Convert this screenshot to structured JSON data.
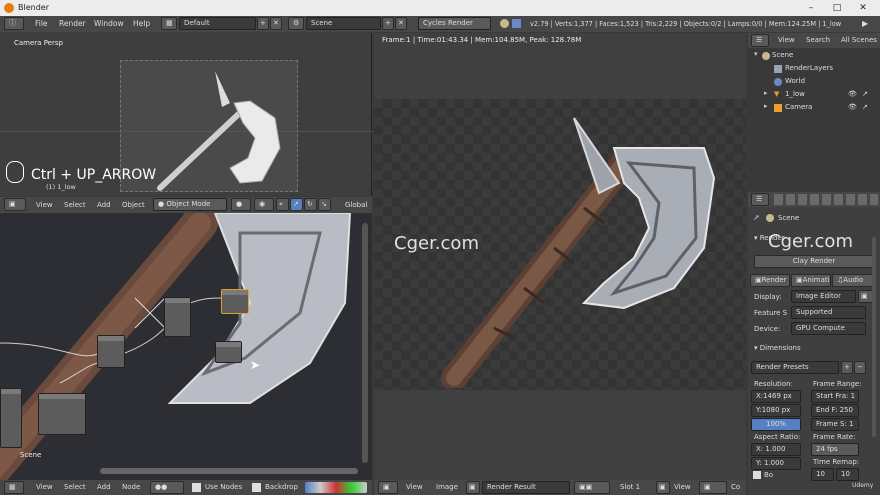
{
  "window": {
    "title": "Blender",
    "controls": [
      "–",
      "□",
      "✕"
    ]
  },
  "menubar": {
    "menus": [
      "File",
      "Render",
      "Window",
      "Help"
    ],
    "layout": "Default",
    "scene": "Scene",
    "engine": "Cycles Render",
    "stats": "v2.79 | Verts:1,377 | Faces:1,523 | Tris:2,229 | Objects:0/2 | Lamps:0/0 | Mem:124.25M | 1_low"
  },
  "viewport3d": {
    "label": "Camera Persp",
    "object_label": "(1) 1_low",
    "shortcut": "Ctrl + UP_ARROW",
    "header": {
      "view": "View",
      "select": "Select",
      "add": "Add",
      "object": "Object",
      "mode": "Object Mode",
      "orientation": "Global"
    }
  },
  "node_editor": {
    "scene_label": "Scene",
    "header": {
      "view": "View",
      "select": "Select",
      "add": "Add",
      "node": "Node",
      "use_nodes": "Use Nodes",
      "backdrop": "Backdrop"
    }
  },
  "render_view": {
    "info": "Frame:1 | Time:01:43.34 | Mem:104.85M, Peak: 128.78M",
    "header": {
      "view": "View",
      "image": "Image",
      "result": "Render Result",
      "slot": "Slot 1",
      "view2": "View",
      "co": "Co"
    }
  },
  "watermarks": {
    "left": "Cger.com",
    "right": "Cger.com",
    "udemy": "Udemy"
  },
  "outliner": {
    "tabs": {
      "view": "View",
      "search": "Search",
      "all_scenes": "All Scenes"
    },
    "items": [
      "Scene",
      "RenderLayers",
      "World",
      "1_low",
      "Camera"
    ]
  },
  "properties": {
    "context": "Scene",
    "render_section": "Render",
    "clay_render": "Clay Render",
    "buttons": {
      "render": "Render",
      "animation": "Animati",
      "audio": "Audio"
    },
    "display": {
      "label": "Display:",
      "value": "Image Editor"
    },
    "feature_set": {
      "label": "Feature S",
      "value": "Supported"
    },
    "device": {
      "label": "Device:",
      "value": "GPU Compute"
    },
    "dimensions": "Dimensions",
    "render_presets": "Render Presets",
    "resolution": {
      "label": "Resolution:",
      "x": "X:1469 px",
      "y": "Y:1080 px",
      "pct": "100%"
    },
    "frame_range": {
      "label": "Frame Range:",
      "start": "Start Fra: 1",
      "end": "End F: 250",
      "step": "Frame S: 1"
    },
    "aspect": {
      "label": "Aspect Ratio:",
      "x_label": "X:",
      "x_val": "1.000",
      "y_label": "Y:",
      "y_val": "1.000"
    },
    "frame_rate": {
      "label": "Frame Rate:",
      "value": "24 fps"
    },
    "time_remap": {
      "label": "Time Remap:",
      "a": "10",
      "b": "10"
    },
    "bo_label": "Bo"
  },
  "colors": {
    "accent": "#5680c2",
    "blender_orange": "#e87d0d"
  }
}
